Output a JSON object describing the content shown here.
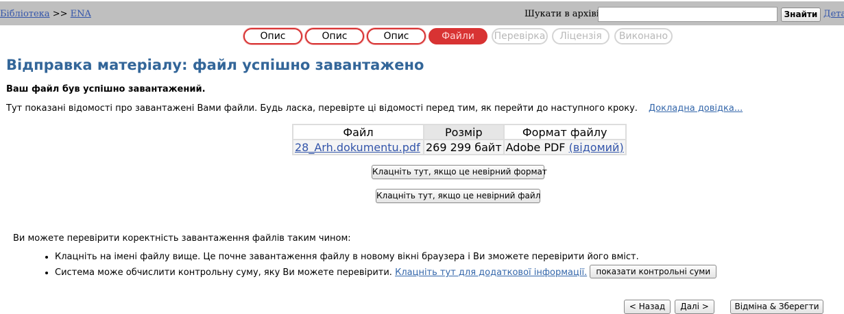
{
  "header": {
    "breadcrumb": {
      "root": "Бібліотека",
      "separator": ">>",
      "collection": "ENA"
    },
    "search_label": "Шукати в архіві",
    "search_value": "",
    "search_button": "Знайти",
    "details_link": "Детал"
  },
  "steps": [
    {
      "label": "Опис",
      "state": "done"
    },
    {
      "label": "Опис",
      "state": "done"
    },
    {
      "label": "Опис",
      "state": "done"
    },
    {
      "label": "Файли",
      "state": "active"
    },
    {
      "label": "Перевірка",
      "state": "todo"
    },
    {
      "label": "Ліцензія",
      "state": "todo"
    },
    {
      "label": "Виконано",
      "state": "todo"
    }
  ],
  "page": {
    "title": "Відправка матеріалу: файл успішно завантажено",
    "success": "Ваш файл був успішно завантажений.",
    "info": "Тут показані відомості про завантажені Вами файли. Будь ласка, перевірте ці відомості перед тим, як перейти до наступного кроку.",
    "help_link": "Докладна довідка..."
  },
  "files_table": {
    "headers": {
      "file": "Файл",
      "size": "Розмір",
      "format": "Формат файлу"
    },
    "rows": [
      {
        "file": "28_Arh.dokumentu.pdf",
        "size": "269 299 байт",
        "format": "Adobe PDF",
        "format_status": "(відомий)"
      }
    ]
  },
  "buttons": {
    "wrong_format": "Клацніть тут, якщо це невірний формат",
    "wrong_file": "Клацніть тут, якщо це невірний файл",
    "show_checksums": "показати контрольні суми",
    "back": "< Назад",
    "next": "Далі >",
    "cancel_save": "Відміна & Зберегти"
  },
  "verify": {
    "intro": "Ви можете перевірити коректність завантаження файлів таким чином:",
    "item1": "Клацніть на імені файлу вище. Це почне завантаження файлу в новому вікні браузера і Ви зможете перевірити його вміст.",
    "item2_text": "Система може обчислити контрольну суму, яку Ви можете перевірити.",
    "item2_link": "Клацніть тут для додаткової інформації."
  }
}
